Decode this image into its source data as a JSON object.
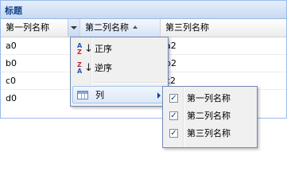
{
  "panel": {
    "title": "标题"
  },
  "columns": [
    {
      "label": "第一列名称"
    },
    {
      "label": "第二列名称"
    },
    {
      "label": "第三列名称"
    }
  ],
  "rows": [
    {
      "c1": "a0",
      "c2": "",
      "c3": "a2"
    },
    {
      "c1": "b0",
      "c2": "",
      "c3": "b2"
    },
    {
      "c1": "c0",
      "c2": "",
      "c3": "c2"
    },
    {
      "c1": "d0",
      "c2": "",
      "c3": ""
    }
  ],
  "column_menu": {
    "items": [
      {
        "label": "正序",
        "icon": "sort-ascending-icon",
        "icon_top": "A",
        "icon_bottom": "Z"
      },
      {
        "label": "逆序",
        "icon": "sort-descending-icon",
        "icon_top": "Z",
        "icon_bottom": "A"
      },
      {
        "label": "列",
        "icon": "columns-icon"
      }
    ]
  },
  "columns_submenu": {
    "items": [
      {
        "label": "第一列名称",
        "checked": true
      },
      {
        "label": "第二列名称",
        "checked": true
      },
      {
        "label": "第三列名称",
        "checked": true
      }
    ],
    "check_glyph": "✓"
  },
  "colors": {
    "panel_border": "#99bbe8",
    "title_text": "#15428b",
    "menu_border": "#718bb7",
    "menu_background": "#f0f0f0"
  }
}
